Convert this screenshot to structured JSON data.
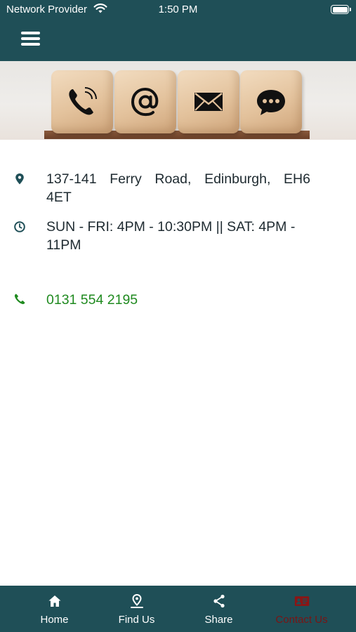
{
  "status_bar": {
    "carrier": "Network Provider",
    "time": "1:50 PM"
  },
  "header": {
    "menu_icon": "hamburger-menu-icon"
  },
  "banner": {
    "blocks": [
      "phone-icon",
      "at-sign-icon",
      "envelope-icon",
      "chat-bubble-icon"
    ]
  },
  "contact": {
    "address": "137-141 Ferry Road, Edinburgh, EH6 4ET",
    "hours": "SUN - FRI: 4PM - 10:30PM || SAT: 4PM - 11PM",
    "phone": "0131 554 2195"
  },
  "tabs": [
    {
      "label": "Home",
      "icon": "home-icon",
      "active": false
    },
    {
      "label": "Find Us",
      "icon": "location-pin-icon",
      "active": false
    },
    {
      "label": "Share",
      "icon": "share-icon",
      "active": false
    },
    {
      "label": "Contact Us",
      "icon": "contact-card-icon",
      "active": true
    }
  ],
  "colors": {
    "header_bg": "#1f4f57",
    "phone_text": "#1f8a1f",
    "active_tab": "#7a1414"
  }
}
